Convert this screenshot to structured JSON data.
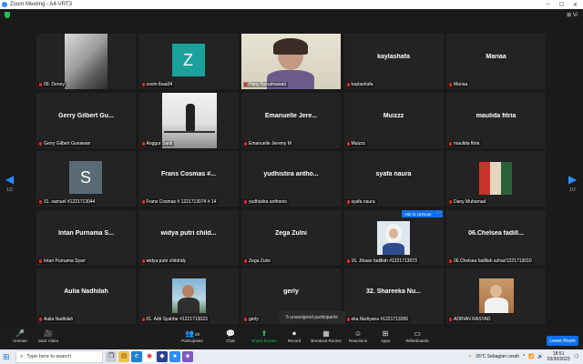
{
  "window": {
    "title": "Zoom Meeting - A4-VRT3",
    "min": "–",
    "max": "☐",
    "close": "✕"
  },
  "top_right": {
    "view_label": "⊞ Vi"
  },
  "pages": {
    "left": "1/2",
    "right": "1/2"
  },
  "tiles": [
    {
      "name": "",
      "label": "09. Denny",
      "kind": "photo",
      "photo": "room"
    },
    {
      "name": "",
      "label": "zoom lbaa04",
      "kind": "avatar",
      "avatar_letter": "Z",
      "avatar_color": "#1aa19b"
    },
    {
      "name": "",
      "label": "Hany Nuraimawati",
      "kind": "photo",
      "photo": "woman",
      "active": true
    },
    {
      "name": "kaylashafa",
      "label": "kaylashafa",
      "kind": "name"
    },
    {
      "name": "Mariaa",
      "label": "Mariaa",
      "kind": "name"
    },
    {
      "name": "Gerry Gilbert Gu...",
      "label": "Gerry Gilbert Gunawan",
      "kind": "name"
    },
    {
      "name": "",
      "label": "Anggur Santi",
      "kind": "photo",
      "photo": "bw"
    },
    {
      "name": "Emanuelle Jere...",
      "label": "Emanuelle Jeremy M",
      "kind": "name"
    },
    {
      "name": "Muizzz",
      "label": "Muizzz",
      "kind": "name"
    },
    {
      "name": "maulida fitria",
      "label": "maulida fitria",
      "kind": "name"
    },
    {
      "name": "",
      "label": "31. samuel #1221713044",
      "kind": "avatar",
      "avatar_letter": "S",
      "avatar_color": "#5b6b75"
    },
    {
      "name": "Frans Cosmas #...",
      "label": "Frans Cosmas # 1221713074 # 14",
      "kind": "name"
    },
    {
      "name": "yudhistira antho...",
      "label": "yudhistira anthonio",
      "kind": "name"
    },
    {
      "name": "syafa naura",
      "label": "syafa naura",
      "kind": "name"
    },
    {
      "name": "",
      "label": "Dany Muhamad",
      "kind": "photo",
      "photo": "collage"
    },
    {
      "name": "Intan Purnama S...",
      "label": "Intan Purnama Syari",
      "kind": "name"
    },
    {
      "name": "widya putri child...",
      "label": "widya putri childridy",
      "kind": "name"
    },
    {
      "name": "Zega Zulni",
      "label": "Zega Zulni",
      "kind": "name"
    },
    {
      "name": "",
      "label": "16. Jihaan fadillah #1221713073",
      "kind": "photo",
      "photo": "hijab"
    },
    {
      "name": "06.Chelsea fadill...",
      "label": "06.Chelsea fadillah azhar/1221713010",
      "kind": "name"
    },
    {
      "name": "Aulia Nadhilah",
      "label": "Aulia Nadhilah",
      "kind": "name"
    },
    {
      "name": "",
      "label": "01. Adit Syahfar #1221713023",
      "kind": "photo",
      "photo": "boy"
    },
    {
      "name": "gerly",
      "label": "gerly",
      "kind": "name"
    },
    {
      "name": "32. Shareeka Nu...",
      "label": "eka Nurliyana #1221713056",
      "kind": "name"
    },
    {
      "name": "",
      "label": "ADRIAN RASYAD",
      "kind": "photo",
      "photo": "man"
    }
  ],
  "popups": {
    "ask_to_unmute": "Ask to Unmute",
    "more": "···",
    "unassigned": "5 unassigned participants"
  },
  "toolbar": {
    "items": [
      {
        "id": "unmute",
        "icon": "🎤",
        "label": "Unmute"
      },
      {
        "id": "video",
        "icon": "🎥",
        "label": "Start Video"
      },
      {
        "id": "participants",
        "icon": "👥",
        "label": "Participants",
        "badge": "28"
      },
      {
        "id": "chat",
        "icon": "💬",
        "label": "Chat"
      },
      {
        "id": "share",
        "icon": "⬆",
        "label": "Share Screen"
      },
      {
        "id": "record",
        "icon": "⏺",
        "label": "Record"
      },
      {
        "id": "breakout",
        "icon": "▦",
        "label": "Breakout Rooms"
      },
      {
        "id": "reactions",
        "icon": "☺",
        "label": "Reactions"
      },
      {
        "id": "apps",
        "icon": "⊞",
        "label": "Apps"
      },
      {
        "id": "whiteboards",
        "icon": "▭",
        "label": "Whiteboards"
      }
    ],
    "leave": "Leave Room"
  },
  "taskbar": {
    "search_placeholder": "Type here to search",
    "weather": "26°C  Sebagian cerah",
    "time": "18:51",
    "date": "03/30/2023"
  }
}
